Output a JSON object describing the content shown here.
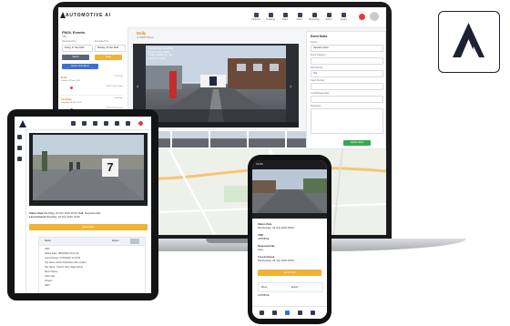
{
  "brand": {
    "name": "AUTOMOTIVE AI"
  },
  "laptop": {
    "nav": [
      {
        "label": "Vehicles",
        "icon": "car-icon"
      },
      {
        "label": "Tracking",
        "icon": "map-pin-icon"
      },
      {
        "label": "Video",
        "icon": "video-icon"
      },
      {
        "label": "Alerts",
        "icon": "bell-icon"
      },
      {
        "label": "Reporting",
        "icon": "chart-icon"
      },
      {
        "label": "Admin",
        "icon": "gear-icon"
      },
      {
        "label": "Assist",
        "icon": "help-icon"
      }
    ],
    "left": {
      "title": "FNOL Events",
      "subtitle": "ABC",
      "from_label": "Start Date/Time",
      "from_value": "Friday, 27 Nov 2020",
      "to_label": "End Date/Time",
      "to_value": "Monday, 30 Nov 2020",
      "search_button": "Search",
      "reset_button": "Reset",
      "export_button": "Export all to Excel",
      "events": [
        {
          "name": "Dolly",
          "meta": "Sunday, 29 Nov 2020",
          "right": "11:08 am",
          "status": "FNOL Event Open"
        },
        {
          "name": "Scrabble",
          "meta": "Saturday, 28 Nov 2020",
          "right": "03:18 pm",
          "status": "FNOL Event Open"
        },
        {
          "name": "Hoover",
          "meta": "Friday, 27 Nov 2020",
          "right": "10:44 am",
          "status": "FNOL Event Open"
        }
      ]
    },
    "main": {
      "title": "Dolly",
      "subtitle": "AUTOMOTIVE AI",
      "video_overlay": [
        "29/11/2020 11:08:54",
        "Door: Front, Dual",
        "Trafs: Gardener, BU",
        "Speed: 0 mph"
      ],
      "form": {
        "title": "Event Notes",
        "fields": [
          {
            "label": "Source",
            "value": "Operator Action"
          },
          {
            "label": "Event Category",
            "value": ""
          },
          {
            "label": "Was Moving",
            "value": "Yes"
          },
          {
            "label": "Claim Number",
            "value": ""
          },
          {
            "label": "Loss/Damage Rate",
            "value": ""
          },
          {
            "label": "Resolution",
            "value": ""
          }
        ],
        "save_button": "Update Notes"
      }
    }
  },
  "tablet": {
    "video_sign": "7",
    "info": [
      {
        "label": "Status Date",
        "value": "Wed/Day, 24 Nov 2020 10:09"
      },
      {
        "label": "Call",
        "value": "Requested By"
      },
      {
        "label": "Last Actioned",
        "value": "Wed/Day, 24 Nov 2020 10:09"
      }
    ],
    "yellow_button": "Save/Close",
    "card_title": "Nurse",
    "card_button": "Export",
    "card_lines": [
      "VRN:",
      "Status Date: 18/04/2020 10:21:33",
      "Last Actioned: 27/04/2020 11:36:56",
      "Org Name: 4020 Information Site Limited",
      "Site Name: Church Farm Sales Street",
      "Driver Name:",
      "Claim Ref:",
      "Closed:",
      "VRN:"
    ]
  },
  "phone": {
    "time": "12:00",
    "info": [
      {
        "label": "Status Date",
        "value": "Wednesday, 29 July 2020 09:09"
      },
      {
        "label": "VRN",
        "value": "AP65BCE"
      },
      {
        "label": "Requested By",
        "value": "Auto"
      },
      {
        "label": "Last Actioned",
        "value": "Wednesday, 29 July 2020 09:09"
      }
    ],
    "yellow_button": "Save/Close",
    "row_left": "Menu",
    "row_mid": "Export",
    "row_right": "AP65BCE"
  },
  "colors": {
    "accent": "#e0851a",
    "save": "#f2b233",
    "ok": "#34a853",
    "dark": "#1d2233"
  }
}
